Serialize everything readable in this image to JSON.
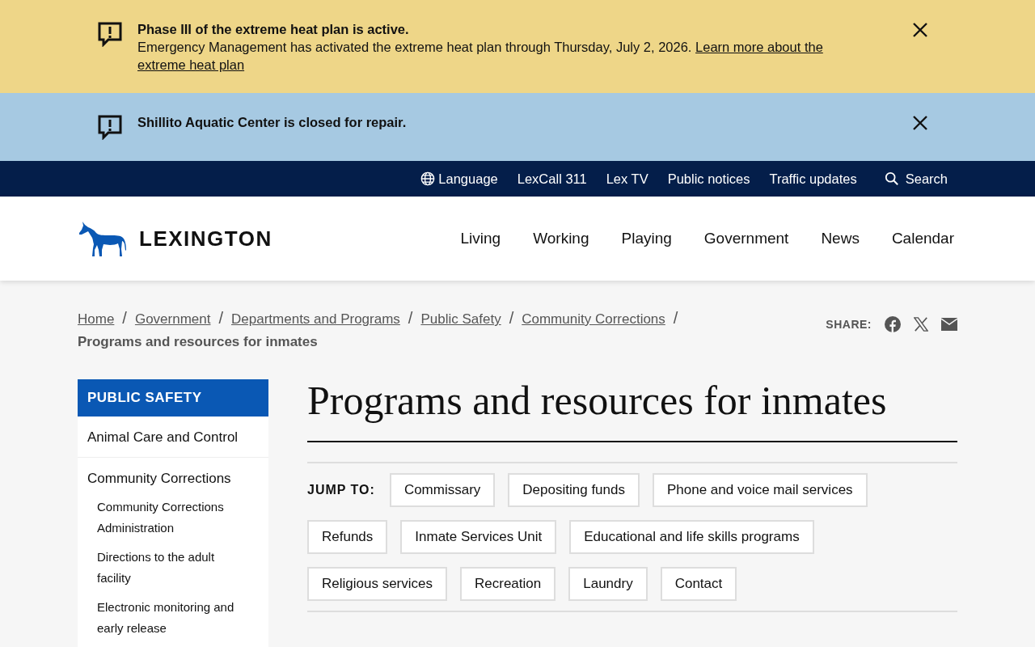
{
  "alerts": [
    {
      "kind": "warning",
      "title": "Phase III of the extreme heat plan is active.",
      "text": "Emergency Management has activated the extreme heat plan through Thursday, July 2, 2026.",
      "link": [
        "Learn more about the",
        "extreme heat plan"
      ]
    },
    {
      "kind": "info",
      "title": "Shillito Aquatic Center is closed for repair."
    }
  ],
  "utility_nav": [
    {
      "kind": "globe",
      "label": "Language"
    },
    {
      "kind": "link",
      "label": "LexCall 311"
    },
    {
      "kind": "link",
      "label": "Lex TV"
    },
    {
      "kind": "link",
      "label": "Public notices"
    },
    {
      "kind": "link",
      "label": "Traffic updates"
    },
    {
      "kind": "search",
      "label": "Search"
    }
  ],
  "logo": {
    "text": "LEXINGTON"
  },
  "main_nav": [
    "Living",
    "Working",
    "Playing",
    "Government",
    "News",
    "Calendar"
  ],
  "breadcrumb": {
    "links": [
      "Home",
      "Government",
      "Departments and Programs",
      "Public Safety",
      "Community Corrections"
    ],
    "separator": "/",
    "current": "Programs and resources for inmates"
  },
  "share": {
    "label": "SHARE:"
  },
  "sidebar": {
    "title": "PUBLIC SAFETY",
    "items": [
      {
        "label": "Animal Care and Control"
      },
      {
        "label": "Community Corrections",
        "children": [
          {
            "label": "Community Corrections Administration"
          },
          {
            "label": "Directions to the adult facility"
          },
          {
            "label": "Electronic monitoring and early release"
          }
        ]
      }
    ]
  },
  "page_title": "Programs and resources for inmates",
  "jump_to": {
    "label": "JUMP TO:",
    "links": [
      "Commissary",
      "Depositing funds",
      "Phone and voice mail services",
      "Refunds",
      "Inmate Services Unit",
      "Educational and life skills programs",
      "Religious services",
      "Recreation",
      "Laundry",
      "Contact"
    ]
  }
}
